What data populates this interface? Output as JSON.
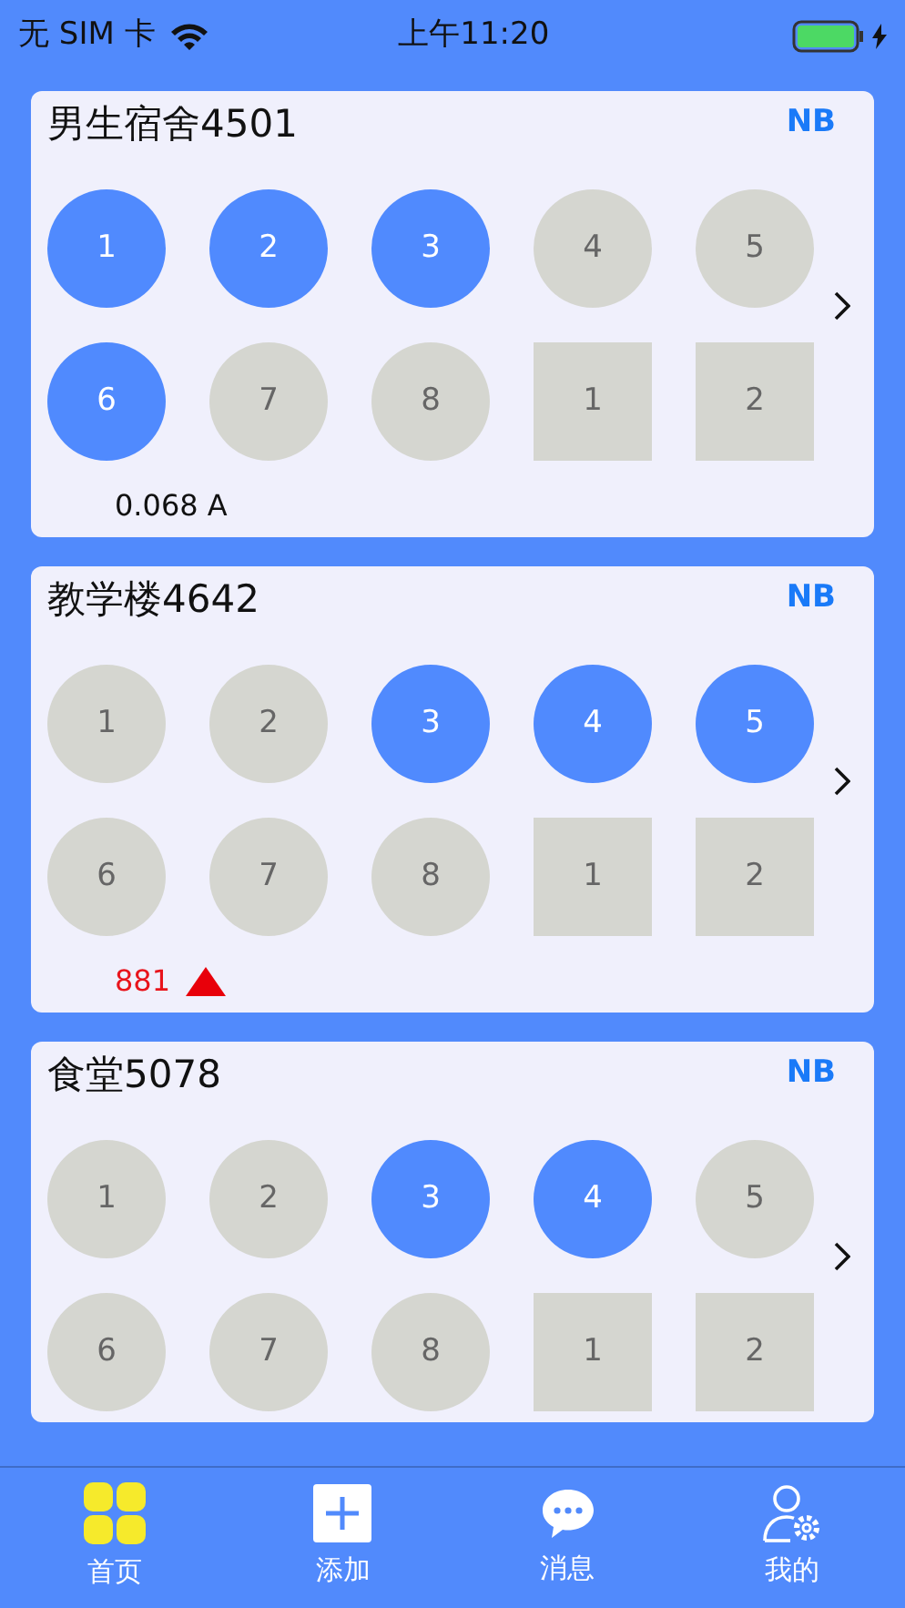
{
  "status_bar": {
    "carrier": "无 SIM 卡",
    "time": "上午11:20"
  },
  "cards": [
    {
      "title": "男生宿舍4501",
      "tag": "NB",
      "switches": [
        {
          "label": "1",
          "kind": "circle",
          "on": true
        },
        {
          "label": "2",
          "kind": "circle",
          "on": true
        },
        {
          "label": "3",
          "kind": "circle",
          "on": true
        },
        {
          "label": "4",
          "kind": "circle",
          "on": false
        },
        {
          "label": "5",
          "kind": "circle",
          "on": false
        },
        {
          "label": "6",
          "kind": "circle",
          "on": true
        },
        {
          "label": "7",
          "kind": "circle",
          "on": false
        },
        {
          "label": "8",
          "kind": "circle",
          "on": false
        },
        {
          "label": "1",
          "kind": "square",
          "on": false
        },
        {
          "label": "2",
          "kind": "square",
          "on": false
        }
      ],
      "reading": {
        "text": "0.068 A",
        "alarm": false
      }
    },
    {
      "title": "教学楼4642",
      "tag": "NB",
      "switches": [
        {
          "label": "1",
          "kind": "circle",
          "on": false
        },
        {
          "label": "2",
          "kind": "circle",
          "on": false
        },
        {
          "label": "3",
          "kind": "circle",
          "on": true
        },
        {
          "label": "4",
          "kind": "circle",
          "on": true
        },
        {
          "label": "5",
          "kind": "circle",
          "on": true
        },
        {
          "label": "6",
          "kind": "circle",
          "on": false
        },
        {
          "label": "7",
          "kind": "circle",
          "on": false
        },
        {
          "label": "8",
          "kind": "circle",
          "on": false
        },
        {
          "label": "1",
          "kind": "square",
          "on": false
        },
        {
          "label": "2",
          "kind": "square",
          "on": false
        }
      ],
      "reading": {
        "text": "881",
        "alarm": true
      }
    },
    {
      "title": "食堂5078",
      "tag": "NB",
      "switches": [
        {
          "label": "1",
          "kind": "circle",
          "on": false
        },
        {
          "label": "2",
          "kind": "circle",
          "on": false
        },
        {
          "label": "3",
          "kind": "circle",
          "on": true
        },
        {
          "label": "4",
          "kind": "circle",
          "on": true
        },
        {
          "label": "5",
          "kind": "circle",
          "on": false
        },
        {
          "label": "6",
          "kind": "circle",
          "on": false
        },
        {
          "label": "7",
          "kind": "circle",
          "on": false
        },
        {
          "label": "8",
          "kind": "circle",
          "on": false
        },
        {
          "label": "1",
          "kind": "square",
          "on": false
        },
        {
          "label": "2",
          "kind": "square",
          "on": false
        }
      ]
    }
  ],
  "tab_bar": [
    {
      "label": "首页",
      "selected": true
    },
    {
      "label": "添加",
      "selected": false
    },
    {
      "label": "消息",
      "selected": false
    },
    {
      "label": "我的",
      "selected": false
    }
  ]
}
